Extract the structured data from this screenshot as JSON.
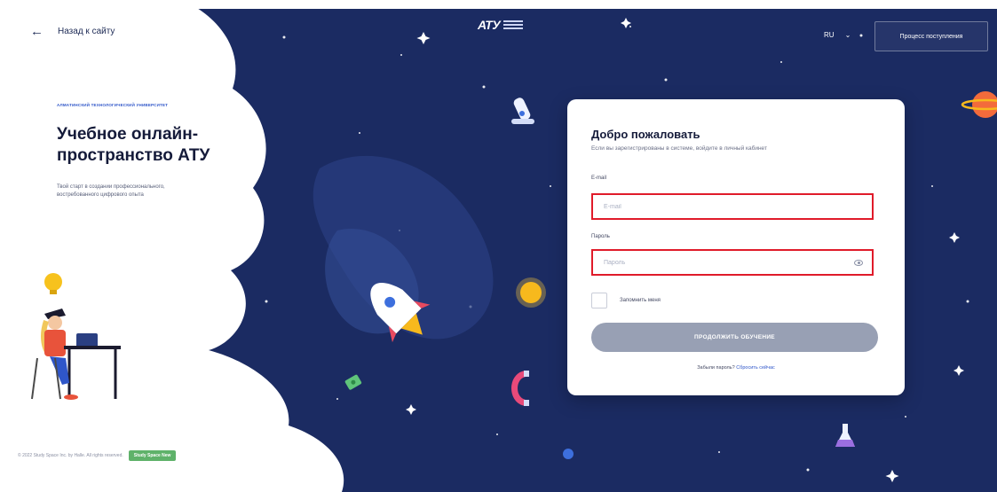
{
  "nav": {
    "back_label": "Назад к сайту",
    "language": "RU",
    "language_chevron": "⌄",
    "admission_label": "Процесс поступления"
  },
  "logo": {
    "mark": "АТУ"
  },
  "hero": {
    "university": "Алматинский технологический университет",
    "title": "Учебное онлайн-пространство АТУ",
    "subtitle": "Твой старт в создании профессионального, востребованного цифрового опыта"
  },
  "login": {
    "title": "Добро пожаловать",
    "subtitle": "Если вы зарегистрированы в системе, войдите в личный кабинет",
    "email_label": "E-mail",
    "email_placeholder": "E-mail",
    "password_label": "Пароль",
    "password_placeholder": "Пароль",
    "remember_label": "Запомнить меня",
    "continue_label": "ПРОДОЛЖИТЬ ОБУЧЕНИЕ",
    "forgot_text": "Забыли пароль?",
    "reset_link": "Сбросить сейчас"
  },
  "footer": {
    "copyright": "© 2022 Study Space Inc. by Halle. All rights reserved.",
    "badge": "Study Space New"
  },
  "icons": {
    "back": "arrow-left-icon",
    "eye": "eye-icon",
    "decor": [
      "rocket-icon",
      "microscope-icon",
      "planet-icon",
      "sun-icon",
      "magnet-icon",
      "flask-icon",
      "student-illustration"
    ]
  },
  "colors": {
    "space": "#1b2b62",
    "accent_red": "#e01b2a",
    "button": "#98a0b4",
    "link": "#2f56c9",
    "planet": "#f36b3b",
    "sun": "#f7b91d"
  }
}
